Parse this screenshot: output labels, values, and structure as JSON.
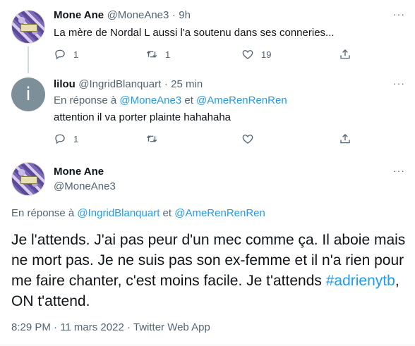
{
  "tweets": [
    {
      "name": "Mone Ane",
      "handle": "@MoneAne3",
      "sep": "·",
      "time": "9h",
      "text": "La mère de Nordal L aussi l'a soutenu dans ses conneries...",
      "replies": "1",
      "retweets": "1",
      "likes": "19"
    },
    {
      "name": "lilou",
      "handle": "@IngridBlanquart",
      "sep": "·",
      "time": "25 min",
      "avatar_letter": "i",
      "reply_prefix": "En réponse à",
      "reply_to_1": "@MoneAne3",
      "reply_joiner": "et",
      "reply_to_2": "@AmeRenRenRen",
      "text": "attention il va porter plainte hahahaha",
      "replies": "1"
    }
  ],
  "main": {
    "name": "Mone Ane",
    "handle": "@MoneAne3",
    "reply_prefix": "En réponse à",
    "reply_to_1": "@IngridBlanquart",
    "reply_joiner": "et",
    "reply_to_2": "@AmeRenRenRen",
    "text_part1": "Je l'attends. J'ai pas peur d'un mec comme ça. Il aboie mais ne mort pas. Je ne suis pas son ex-femme et il n'a rien pour me faire chanter,  c'est moins facile. Je t'attends ",
    "hashtag": "#adrienytb",
    "text_part2": ", ON t'attend.",
    "meta": "8:29 PM · 11 mars 2022 · Twitter Web App"
  },
  "more_icon": "···",
  "colors": {
    "link": "#1d9bf0",
    "muted": "#536471",
    "text": "#0f1419"
  }
}
